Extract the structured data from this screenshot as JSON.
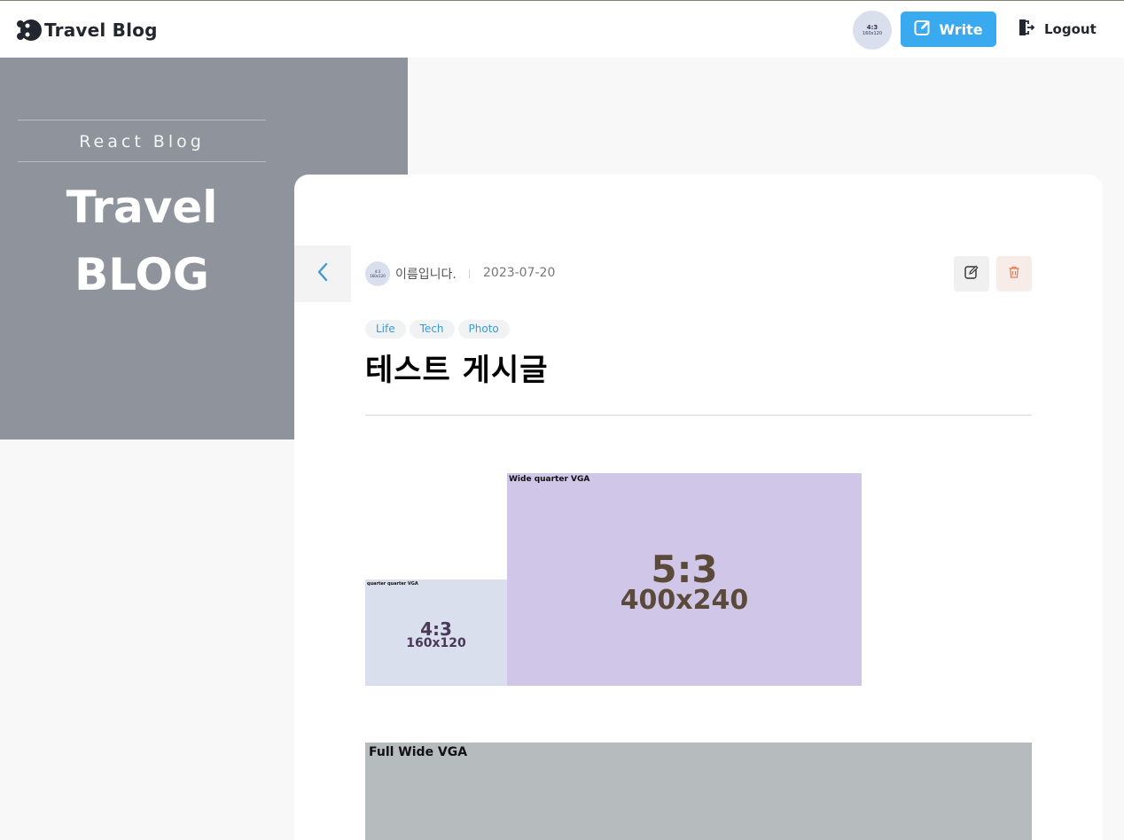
{
  "header": {
    "logo_text": "Travel Blog",
    "avatar": {
      "ratio": "4:3",
      "size": "160x120"
    },
    "write_label": "Write",
    "logout_label": "Logout"
  },
  "hero": {
    "subtitle": "React Blog",
    "title_line1": "Travel",
    "title_line2": "BLOG"
  },
  "post": {
    "author_name": "이름입니다.",
    "author_avatar": {
      "ratio": "4:3",
      "size": "160x120"
    },
    "date": "2023-07-20",
    "tags": [
      "Life",
      "Tech",
      "Photo"
    ],
    "title": "테스트 게시글"
  },
  "images": {
    "small": {
      "caption": "quarter quarter VGA",
      "ratio": "4:3",
      "size": "160x120"
    },
    "wide": {
      "caption": "Wide quarter VGA",
      "ratio": "5:3",
      "size": "400x240"
    },
    "full": {
      "caption": "Full Wide VGA"
    }
  },
  "colors": {
    "accent": "#3aaaf0",
    "hero_bg": "#8f949c",
    "delete": "#e2815e"
  }
}
